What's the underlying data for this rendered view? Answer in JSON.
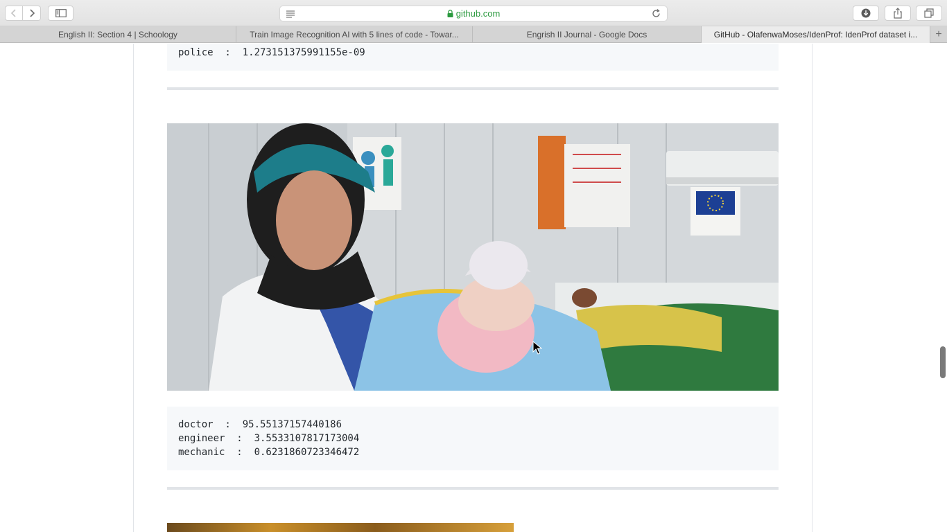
{
  "browser": {
    "url": "github.com",
    "tabs": [
      {
        "title": "English II: Section 4 | Schoology",
        "active": false
      },
      {
        "title": "Train Image Recognition AI with 5 lines of code - Towar...",
        "active": false
      },
      {
        "title": "Engrish II Journal - Google Docs",
        "active": false
      },
      {
        "title": "GitHub - OlafenwaMoses/IdenProf: IdenProf dataset i...",
        "active": true
      }
    ],
    "new_tab_label": "+",
    "icons": {
      "back": "chevron-left-icon",
      "forward": "chevron-right-icon",
      "sidebar": "sidebar-icon",
      "reader": "reader-icon",
      "lock": "lock-icon",
      "reload": "reload-icon",
      "download": "download-icon",
      "share": "share-icon",
      "tabs": "tabs-overview-icon"
    },
    "colors": {
      "url": "#2b9a3f",
      "chrome": "#e6e6e6",
      "active_tab": "#ececec"
    }
  },
  "page": {
    "prediction_prev": {
      "lines": [
        "police  :  1.273151375991155e-09"
      ]
    },
    "prediction_doctor": {
      "lines": [
        "doctor  :  95.55137157440186",
        "engineer  :  3.5533107817173004",
        "mechanic  :  0.6231860723346472"
      ]
    },
    "code_background": "#f6f8fa",
    "divider_color": "#e1e4e8"
  }
}
